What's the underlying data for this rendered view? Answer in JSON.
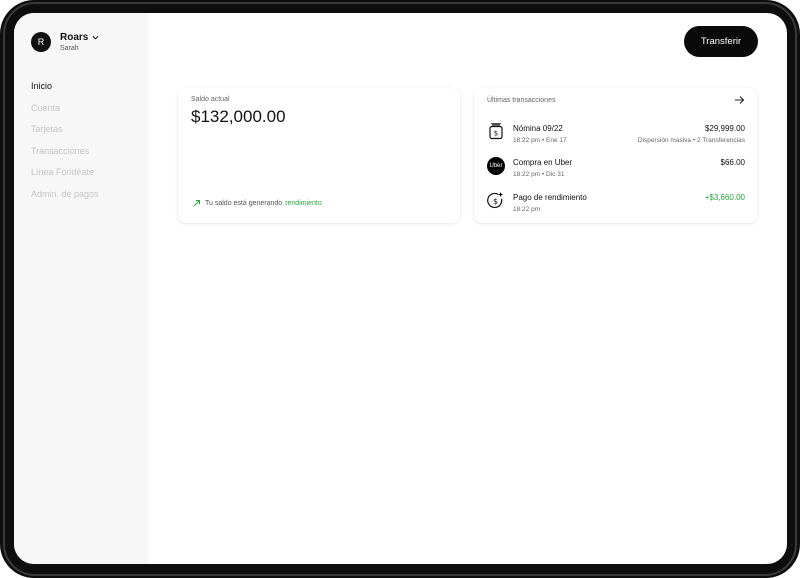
{
  "account": {
    "initial": "R",
    "name": "Roars",
    "user": "Sarah"
  },
  "nav": {
    "items": [
      {
        "label": "Inicio",
        "active": true
      },
      {
        "label": "Cuenta",
        "active": false
      },
      {
        "label": "Tarjetas",
        "active": false
      },
      {
        "label": "Transacciones",
        "active": false
      },
      {
        "label": "Línea Fondéate",
        "active": false
      },
      {
        "label": "Admin. de pagos",
        "active": false
      }
    ]
  },
  "header": {
    "transfer_label": "Transferir"
  },
  "balance": {
    "label": "Saldo actual",
    "amount": "$132,000.00",
    "yield_text": "Tu saldo está generando",
    "yield_link": "rendimiento"
  },
  "transactions": {
    "title": "Últimas transacciones",
    "items": [
      {
        "icon": "payroll-icon",
        "name": "Nómina 09/22",
        "time": "18:22 pm",
        "date": "Ene 17",
        "amount": "$29,999.00",
        "detail": "Dispersión masiva",
        "detail2": "2 Transferencias"
      },
      {
        "icon": "uber-logo",
        "logo_text": "Uber",
        "name": "Compra en Uber",
        "time": "18:22 pm",
        "date": "Dic 31",
        "amount": "$66.00"
      },
      {
        "icon": "dollar-yield-icon",
        "name": "Pago de rendimiento",
        "time": "18:22 pm",
        "amount": "+$3,660.00"
      }
    ]
  },
  "colors": {
    "accent_green": "#27a53b",
    "button_bg": "#0a0a0a",
    "sidebar_bg": "#f7f7f7",
    "inactive_nav": "#c4c4c4"
  }
}
